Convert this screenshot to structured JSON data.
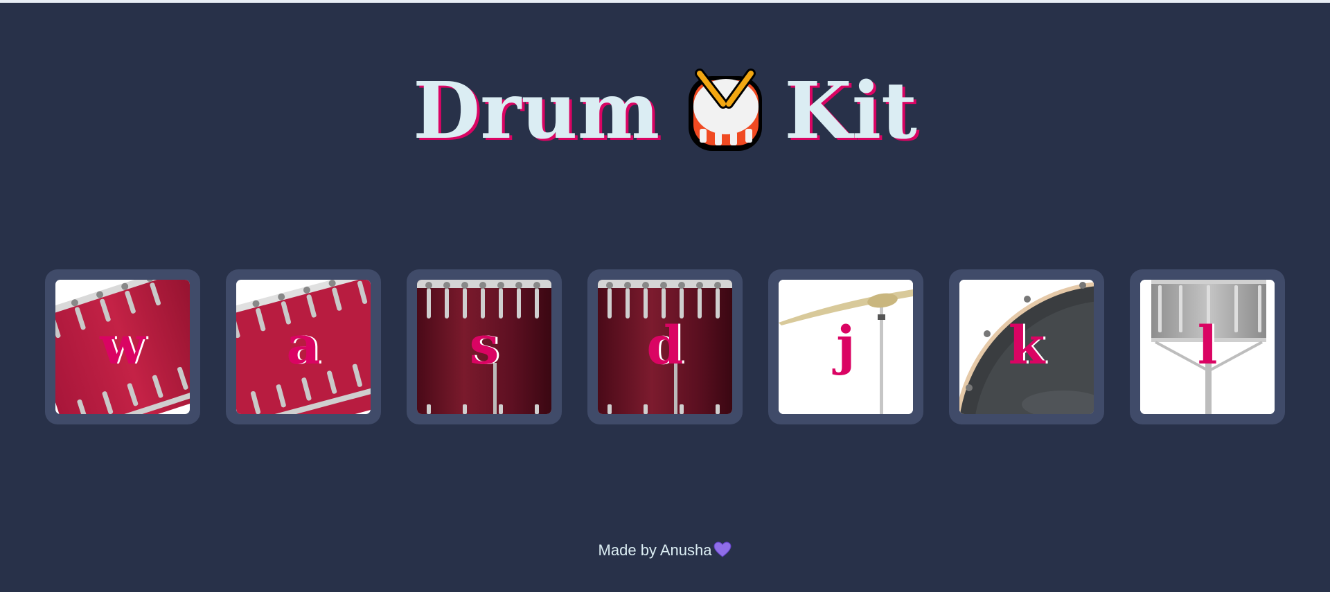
{
  "header": {
    "title_left": "Drum",
    "title_right": "Kit",
    "title_icon": "drum-emoji-icon"
  },
  "pads": [
    {
      "key": "w",
      "instrument_icon": "tom-drum-icon"
    },
    {
      "key": "a",
      "instrument_icon": "tom-drum-icon"
    },
    {
      "key": "s",
      "instrument_icon": "floor-tom-icon"
    },
    {
      "key": "d",
      "instrument_icon": "floor-tom-icon"
    },
    {
      "key": "j",
      "instrument_icon": "cymbal-icon"
    },
    {
      "key": "k",
      "instrument_icon": "bass-drum-icon"
    },
    {
      "key": "l",
      "instrument_icon": "snare-drum-icon"
    }
  ],
  "footer": {
    "text": "Made by Anusha",
    "icon": "purple-heart-icon"
  },
  "colors": {
    "background": "#283149",
    "pad_frame": "#404b69",
    "accent": "#da0463",
    "title_text": "#dbedf3"
  }
}
